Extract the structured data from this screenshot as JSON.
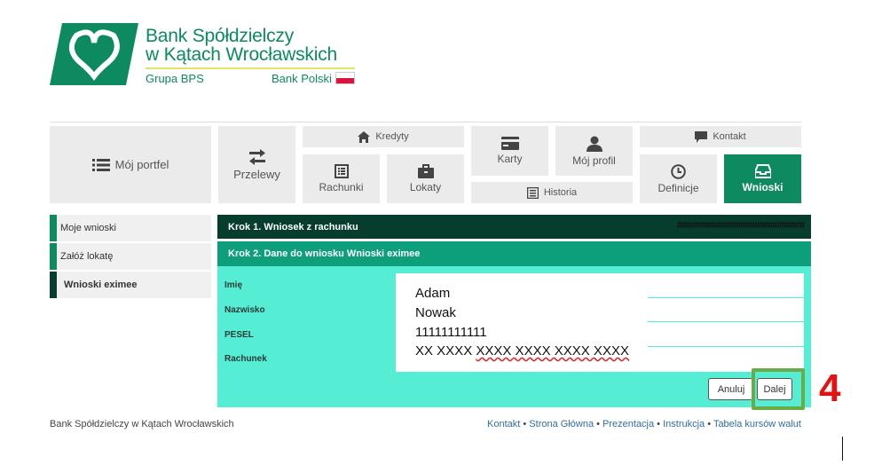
{
  "brand": {
    "name_line1": "Bank Spółdzielczy",
    "name_line2": "w Kątach Wrocławskich",
    "group": "Grupa BPS",
    "bank_polski": "Bank Polski",
    "brand_green": "#0d8a5f",
    "dark_green": "#063d2f",
    "accent_mint": "#55edd4"
  },
  "nav": {
    "portfolio": "Mój portfel",
    "transfers": "Przelewy",
    "credits": "Kredyty",
    "accounts": "Rachunki",
    "deposits": "Lokaty",
    "cards": "Karty",
    "history": "Historia",
    "profile": "Mój profil",
    "contact": "Kontakt",
    "definitions": "Definicje",
    "applications": "Wnioski"
  },
  "sidebar": {
    "items": [
      {
        "label": "Moje wnioski",
        "active": false
      },
      {
        "label": "Załóż lokatę",
        "active": false
      },
      {
        "label": "Wnioski eximee",
        "active": true
      }
    ]
  },
  "steps": {
    "step1": "Krok 1. Wniosek z rachunku",
    "step1_right": "############################",
    "step2": "Krok 2. Dane do wniosku Wnioski eximee"
  },
  "form": {
    "fields": [
      {
        "label": "Imię",
        "value": "Adam"
      },
      {
        "label": "Nazwisko",
        "value": "Nowak"
      },
      {
        "label": "PESEL",
        "value": "11111111111"
      },
      {
        "label": "Rachunek",
        "value_prefix": "XX XXXX ",
        "value_spell": "XXXX XXXX XXXX XXXX"
      }
    ],
    "cancel_label": "Anuluj",
    "next_label": "Dalej"
  },
  "annotation": {
    "step_number": "4",
    "highlight_color": "#6aab47",
    "number_color": "#e51212"
  },
  "footer": {
    "left": "Bank Spółdzielczy w Kątach Wrocławskich",
    "sep": " • ",
    "links": [
      "Kontakt",
      "Strona Główna",
      "Prezentacja",
      "Instrukcja",
      "Tabela kursów walut"
    ]
  }
}
